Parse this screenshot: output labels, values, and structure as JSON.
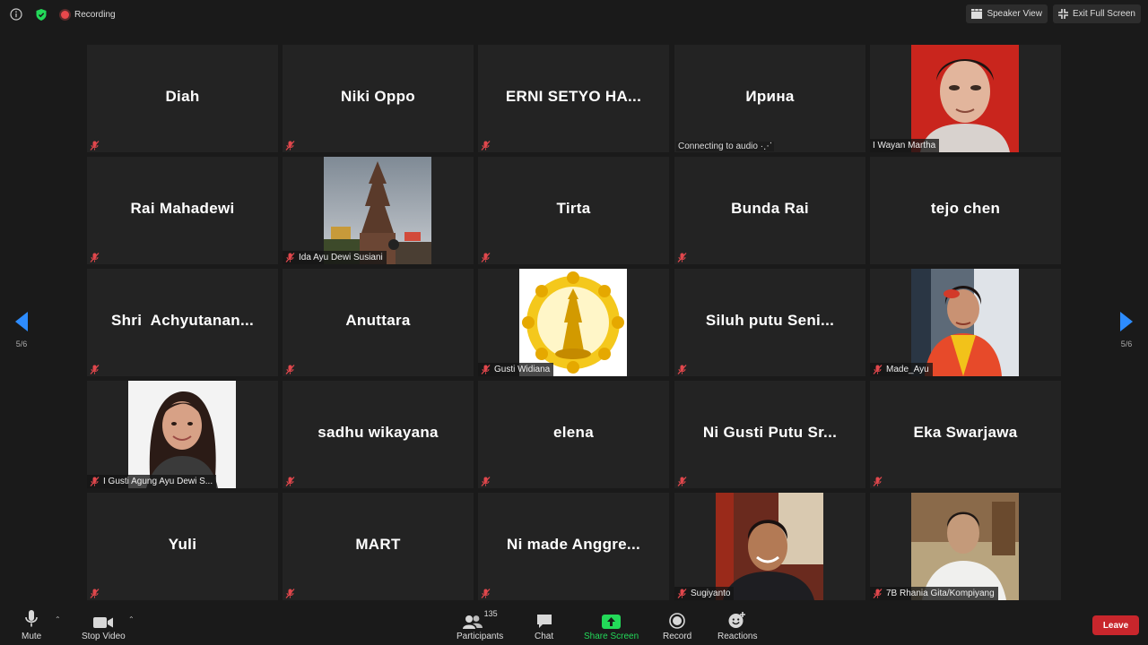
{
  "top_bar": {
    "recording_label": "Recording",
    "speaker_view_label": "Speaker View",
    "exit_full_screen_label": "Exit Full Screen"
  },
  "pagination": {
    "left_label": "5/6",
    "right_label": "5/6"
  },
  "participants_grid": [
    {
      "name": "Diah",
      "has_video": false
    },
    {
      "name": "Niki Oppo",
      "has_video": false
    },
    {
      "name": "ERNI SETYO HA...",
      "has_video": false
    },
    {
      "name": "Ирина",
      "has_video": false,
      "status": "Connecting to audio"
    },
    {
      "name": "I Wayan Martha",
      "has_video": true
    },
    {
      "name": "Rai Mahadewi",
      "has_video": false
    },
    {
      "name": "Ida Ayu Dewi Susiani",
      "has_video": true
    },
    {
      "name": "Tirta",
      "has_video": false
    },
    {
      "name": "Bunda Rai",
      "has_video": false
    },
    {
      "name": "tejo chen",
      "has_video": false
    },
    {
      "name": "Shri  Achyutanan...",
      "has_video": false
    },
    {
      "name": "Anuttara",
      "has_video": false
    },
    {
      "name": "Gusti Widiana",
      "has_video": true
    },
    {
      "name": "Siluh putu Seni...",
      "has_video": false
    },
    {
      "name": "Made_Ayu",
      "has_video": true
    },
    {
      "name": "I Gusti Agung Ayu Dewi S...",
      "has_video": true
    },
    {
      "name": "sadhu wikayana",
      "has_video": false
    },
    {
      "name": "elena",
      "has_video": false
    },
    {
      "name": "Ni Gusti Putu Sr...",
      "has_video": false
    },
    {
      "name": "Eka Swarjawa",
      "has_video": false
    },
    {
      "name": "Yuli",
      "has_video": false
    },
    {
      "name": "MART",
      "has_video": false
    },
    {
      "name": "Ni made Anggre...",
      "has_video": false
    },
    {
      "name": "Sugiyanto",
      "has_video": true
    },
    {
      "name": "7B Rhania Gita/Kompiyang",
      "has_video": true
    }
  ],
  "toolbar": {
    "mute_label": "Mute",
    "stop_video_label": "Stop Video",
    "participants_label": "Participants",
    "participants_count": "135",
    "chat_label": "Chat",
    "share_screen_label": "Share Screen",
    "record_label": "Record",
    "reactions_label": "Reactions",
    "leave_label": "Leave"
  },
  "colors": {
    "background": "#1a1a1a",
    "tile": "#232323",
    "share_screen_green": "#23d959",
    "leave_red": "#c8262c",
    "nav_arrow_blue": "#2d8cff",
    "mute_red": "#e0474c"
  }
}
